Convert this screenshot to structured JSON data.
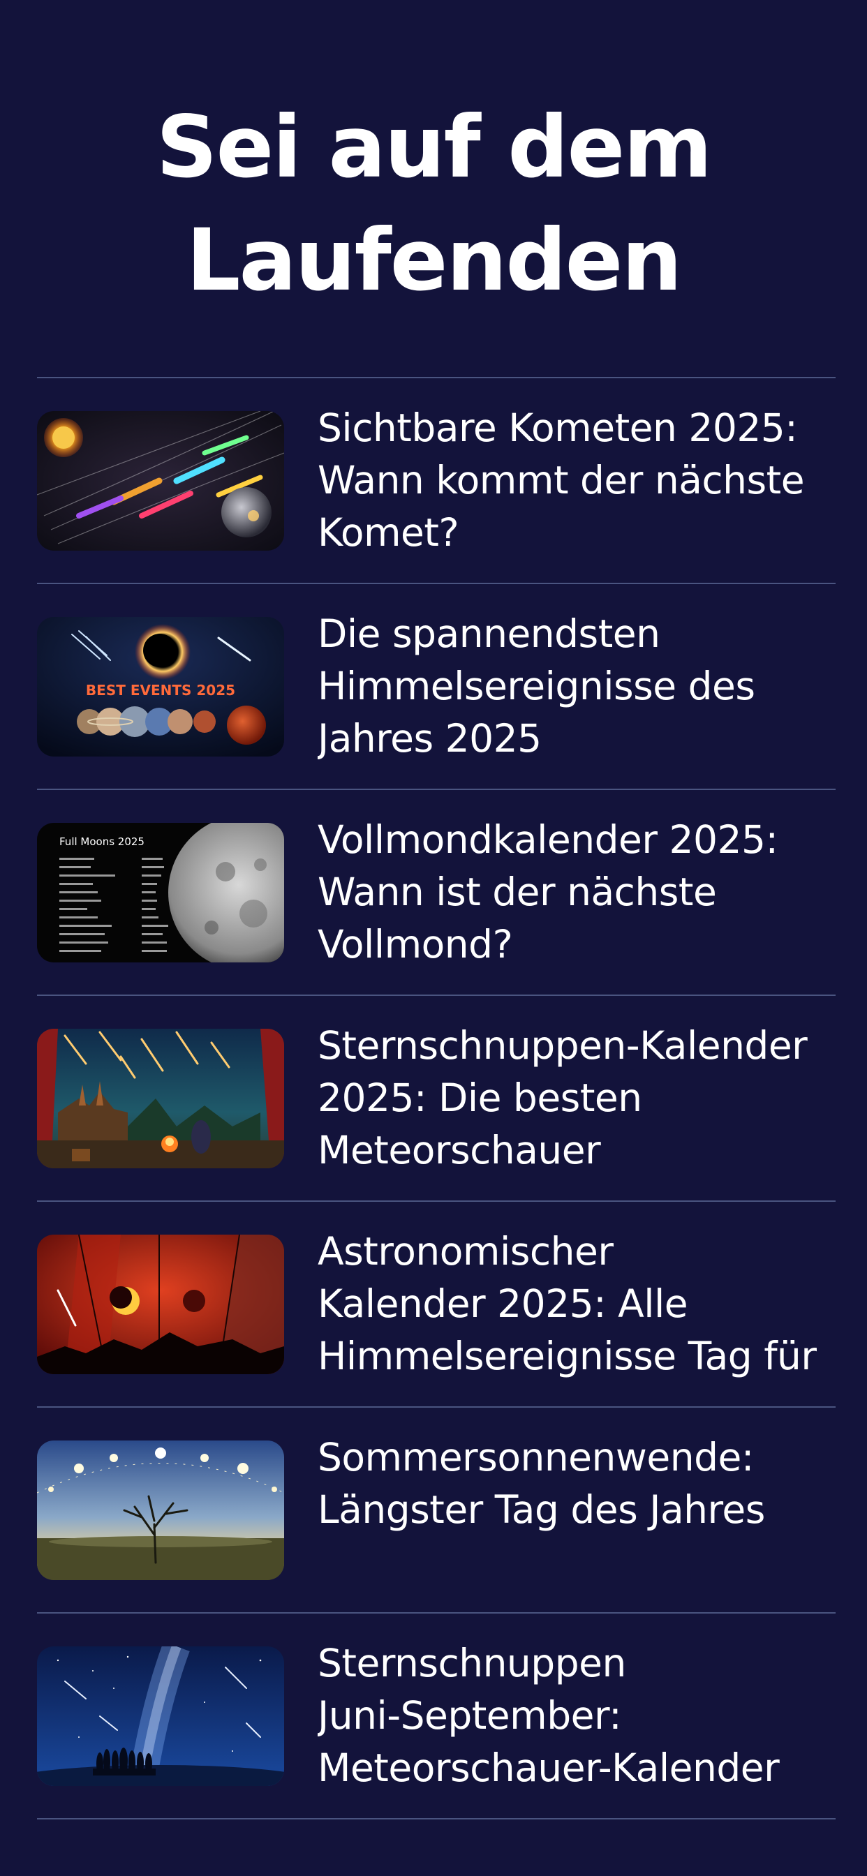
{
  "heading": {
    "line1": "Sei auf dem",
    "line2": "Laufenden"
  },
  "articles": [
    {
      "title": "Sichtbare Kometen 2025:\nWann kommt der nächste\nKomet?",
      "thumbnail": "comets-icon"
    },
    {
      "title": "Die spannendsten\nHimmelsereignisse des\nJahres 2025",
      "thumbnail": "best-events-icon",
      "thumb_text": "BEST EVENTS 2025"
    },
    {
      "title": "Vollmondkalender 2025:\nWann ist der nächste\nVollmond?",
      "thumbnail": "full-moon-icon",
      "thumb_text": "Full Moons 2025"
    },
    {
      "title": "Sternschnuppen-Kalender\n2025: Die besten\nMeteorschauer",
      "thumbnail": "meteor-night-icon"
    },
    {
      "title": "Astronomischer\nKalender 2025: Alle\nHimmelsereignisse Tag für",
      "thumbnail": "eclipse-panels-icon"
    },
    {
      "title": "Sommersonnenwende:\nLängster Tag des Jahres",
      "thumbnail": "solstice-icon"
    },
    {
      "title": "Sternschnuppen\nJuni-September:\nMeteorschauer-Kalender",
      "thumbnail": "milky-way-icon"
    }
  ],
  "colors": {
    "background": "#13133b",
    "divider": "#4a5480",
    "text": "#ffffff"
  }
}
